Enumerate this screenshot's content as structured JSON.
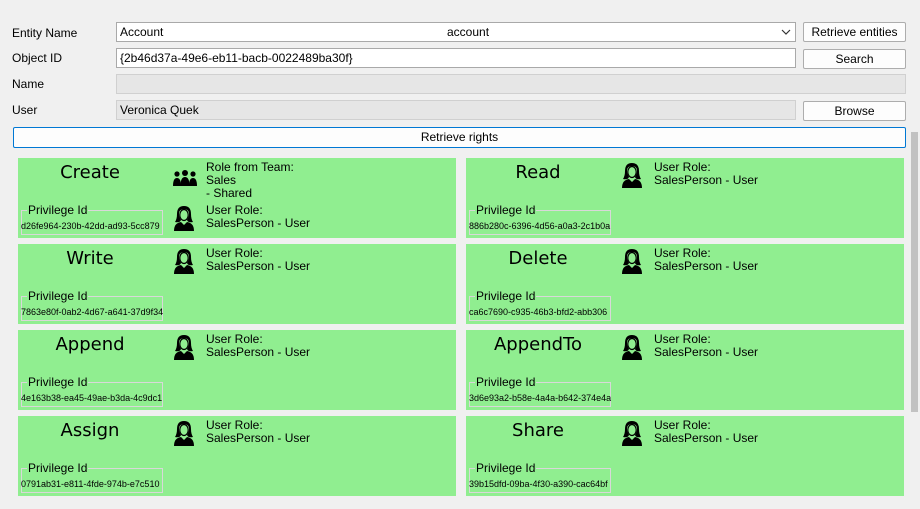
{
  "form": {
    "entity_label": "Entity Name",
    "entity_display": "Account",
    "entity_logical": "account",
    "retrieve_entities_label": "Retrieve entities",
    "objectid_label": "Object ID",
    "objectid_value": "{2b46d37a-49e6-eb11-bacb-0022489ba30f}",
    "search_label": "Search",
    "name_label": "Name",
    "name_value": "",
    "user_label": "User",
    "user_value": "Veronica Quek",
    "browse_label": "Browse",
    "retrieve_rights_label": "Retrieve rights"
  },
  "privilege_label": "Privilege Id",
  "rights": [
    {
      "title": "Create",
      "privilege_id": "d26fe964-230b-42dd-ad93-5cc879",
      "roles": [
        {
          "icon": "team-icon",
          "line1": "Role from Team: Sales",
          "line2": "- Shared"
        },
        {
          "icon": "user-icon",
          "line1": "User Role:",
          "line2": "SalesPerson - User"
        }
      ]
    },
    {
      "title": "Read",
      "privilege_id": "886b280c-6396-4d56-a0a3-2c1b0a",
      "roles": [
        {
          "icon": "user-icon",
          "line1": "User Role:",
          "line2": "SalesPerson - User"
        }
      ]
    },
    {
      "title": "Write",
      "privilege_id": "7863e80f-0ab2-4d67-a641-37d9f34",
      "roles": [
        {
          "icon": "user-icon",
          "line1": "User Role:",
          "line2": "SalesPerson - User"
        }
      ]
    },
    {
      "title": "Delete",
      "privilege_id": "ca6c7690-c935-46b3-bfd2-abb306",
      "roles": [
        {
          "icon": "user-icon",
          "line1": "User Role:",
          "line2": "SalesPerson - User"
        }
      ]
    },
    {
      "title": "Append",
      "privilege_id": "4e163b38-ea45-49ae-b3da-4c9dc1",
      "roles": [
        {
          "icon": "user-icon",
          "line1": "User Role:",
          "line2": "SalesPerson - User"
        }
      ]
    },
    {
      "title": "AppendTo",
      "privilege_id": "3d6e93a2-b58e-4a4a-b642-374e4a",
      "roles": [
        {
          "icon": "user-icon",
          "line1": "User Role:",
          "line2": "SalesPerson - User"
        }
      ]
    },
    {
      "title": "Assign",
      "privilege_id": "0791ab31-e811-4fde-974b-e7c510",
      "roles": [
        {
          "icon": "user-icon",
          "line1": "User Role:",
          "line2": "SalesPerson - User"
        }
      ]
    },
    {
      "title": "Share",
      "privilege_id": "39b15dfd-09ba-4f30-a390-cac64bf",
      "roles": [
        {
          "icon": "user-icon",
          "line1": "User Role:",
          "line2": "SalesPerson - User"
        }
      ]
    }
  ],
  "colors": {
    "card_bg": "#90ee90",
    "accent": "#0078d4"
  }
}
